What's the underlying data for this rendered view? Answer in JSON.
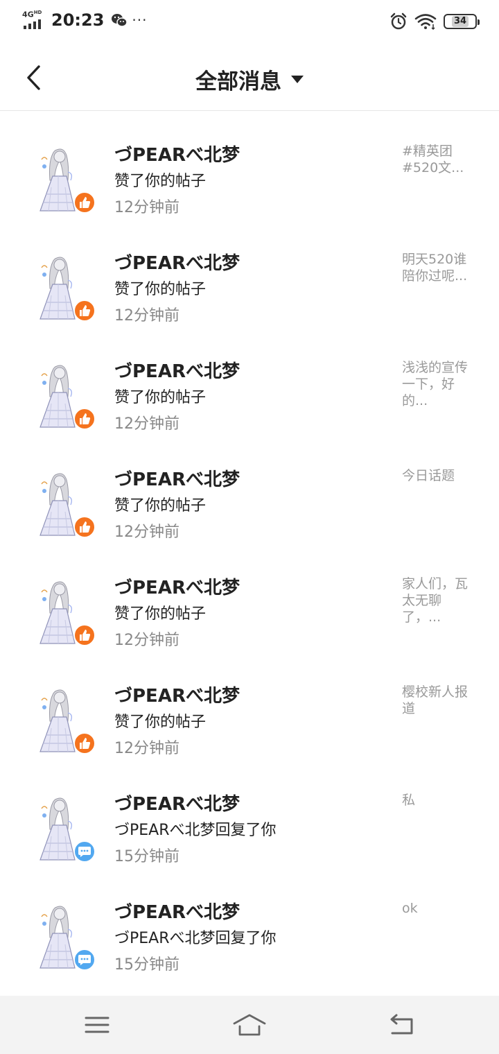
{
  "status_bar": {
    "network": "4G",
    "network_sup": "HD",
    "time": "20:23",
    "dots": "···",
    "battery": "34"
  },
  "header": {
    "title": "全部消息"
  },
  "messages": [
    {
      "name": "づPEARべ北梦",
      "action": "赞了你的帖子",
      "time": "12分钟前",
      "preview": "#精英团 #520文...",
      "type": "like"
    },
    {
      "name": "づPEARべ北梦",
      "action": "赞了你的帖子",
      "time": "12分钟前",
      "preview": "明天520谁陪你过呢...",
      "type": "like"
    },
    {
      "name": "づPEARべ北梦",
      "action": "赞了你的帖子",
      "time": "12分钟前",
      "preview": "浅浅的宣传一下，好的...",
      "type": "like"
    },
    {
      "name": "づPEARべ北梦",
      "action": "赞了你的帖子",
      "time": "12分钟前",
      "preview": "今日话题",
      "type": "like"
    },
    {
      "name": "づPEARべ北梦",
      "action": "赞了你的帖子",
      "time": "12分钟前",
      "preview": "家人们，瓦太无聊了，...",
      "type": "like"
    },
    {
      "name": "づPEARべ北梦",
      "action": "赞了你的帖子",
      "time": "12分钟前",
      "preview": "樱校新人报道",
      "type": "like"
    },
    {
      "name": "づPEARべ北梦",
      "action": "づPEARべ北梦回复了你",
      "time": "15分钟前",
      "preview": "私",
      "type": "reply"
    },
    {
      "name": "づPEARべ北梦",
      "action": "づPEARべ北梦回复了你",
      "time": "15分钟前",
      "preview": "ok",
      "type": "reply"
    }
  ],
  "icons": {
    "like_badge": "thumbs-up-icon",
    "reply_badge": "chat-bubble-icon"
  },
  "colors": {
    "like_badge": "#f5731e",
    "reply_badge": "#52a8f0",
    "secondary_text": "#888888",
    "preview_text": "#999999"
  }
}
